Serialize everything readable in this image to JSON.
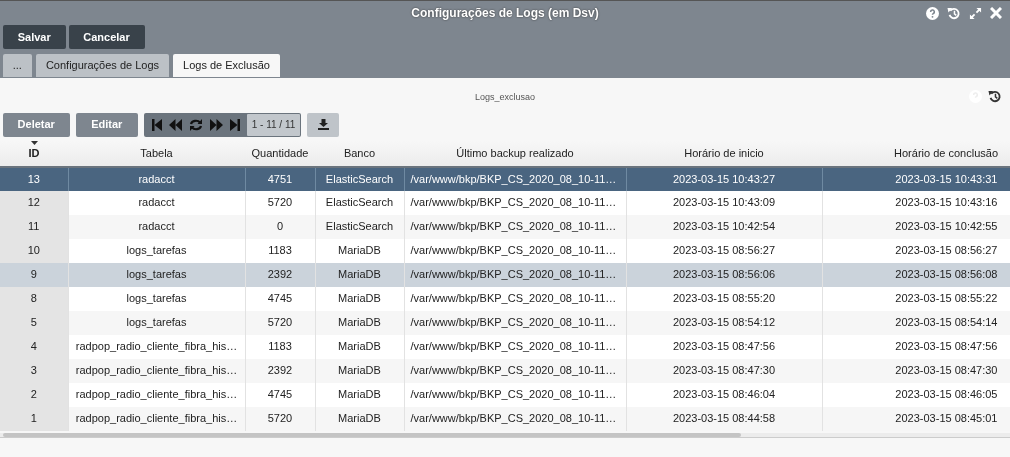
{
  "window": {
    "title": "Configurações de Logs (em Dsv)"
  },
  "actions": [
    "Salvar",
    "Cancelar"
  ],
  "tabs": [
    {
      "label": "...",
      "selected": false
    },
    {
      "label": "Configurações de Logs",
      "selected": false
    },
    {
      "label": "Logs de Exclusão",
      "selected": true
    }
  ],
  "panel": {
    "title": "Logs_exclusao"
  },
  "toolbar": {
    "buttons": [
      "Deletar",
      "Editar"
    ],
    "pager": "1 - 11 / 11"
  },
  "table": {
    "columns": [
      {
        "label": "ID",
        "sorted": true
      },
      {
        "label": "Tabela",
        "sorted": false
      },
      {
        "label": "Quantidade",
        "sorted": false
      },
      {
        "label": "Banco",
        "sorted": false
      },
      {
        "label": "Último backup realizado",
        "sorted": false
      },
      {
        "label": "Horário de inicio",
        "sorted": false
      },
      {
        "label": "Horário de conclusão",
        "sorted": false
      }
    ],
    "rows": [
      {
        "cells": [
          "13",
          "radacct",
          "4751",
          "ElasticSearch",
          "/var/www/bkp/BKP_CS_2020_08_10-11…",
          "2023-03-15 10:43:27",
          "2023-03-15 10:43:31"
        ],
        "selected": true,
        "hovered": false
      },
      {
        "cells": [
          "12",
          "radacct",
          "5720",
          "ElasticSearch",
          "/var/www/bkp/BKP_CS_2020_08_10-11…",
          "2023-03-15 10:43:09",
          "2023-03-15 10:43:16"
        ],
        "selected": false,
        "hovered": false
      },
      {
        "cells": [
          "11",
          "radacct",
          "0",
          "ElasticSearch",
          "/var/www/bkp/BKP_CS_2020_08_10-11…",
          "2023-03-15 10:42:54",
          "2023-03-15 10:42:55"
        ],
        "selected": false,
        "hovered": false
      },
      {
        "cells": [
          "10",
          "logs_tarefas",
          "1183",
          "MariaDB",
          "/var/www/bkp/BKP_CS_2020_08_10-11…",
          "2023-03-15 08:56:27",
          "2023-03-15 08:56:27"
        ],
        "selected": false,
        "hovered": false
      },
      {
        "cells": [
          "9",
          "logs_tarefas",
          "2392",
          "MariaDB",
          "/var/www/bkp/BKP_CS_2020_08_10-11…",
          "2023-03-15 08:56:06",
          "2023-03-15 08:56:08"
        ],
        "selected": false,
        "hovered": true
      },
      {
        "cells": [
          "8",
          "logs_tarefas",
          "4745",
          "MariaDB",
          "/var/www/bkp/BKP_CS_2020_08_10-11…",
          "2023-03-15 08:55:20",
          "2023-03-15 08:55:22"
        ],
        "selected": false,
        "hovered": false
      },
      {
        "cells": [
          "5",
          "logs_tarefas",
          "5720",
          "MariaDB",
          "/var/www/bkp/BKP_CS_2020_08_10-11…",
          "2023-03-15 08:54:12",
          "2023-03-15 08:54:14"
        ],
        "selected": false,
        "hovered": false
      },
      {
        "cells": [
          "4",
          "radpop_radio_cliente_fibra_his…",
          "1183",
          "MariaDB",
          "/var/www/bkp/BKP_CS_2020_08_10-11…",
          "2023-03-15 08:47:56",
          "2023-03-15 08:47:56"
        ],
        "selected": false,
        "hovered": false
      },
      {
        "cells": [
          "3",
          "radpop_radio_cliente_fibra_his…",
          "2392",
          "MariaDB",
          "/var/www/bkp/BKP_CS_2020_08_10-11…",
          "2023-03-15 08:47:30",
          "2023-03-15 08:47:30"
        ],
        "selected": false,
        "hovered": false
      },
      {
        "cells": [
          "2",
          "radpop_radio_cliente_fibra_his…",
          "4745",
          "MariaDB",
          "/var/www/bkp/BKP_CS_2020_08_10-11…",
          "2023-03-15 08:46:04",
          "2023-03-15 08:46:05"
        ],
        "selected": false,
        "hovered": false
      },
      {
        "cells": [
          "1",
          "radpop_radio_cliente_fibra_his…",
          "5720",
          "MariaDB",
          "/var/www/bkp/BKP_CS_2020_08_10-11…",
          "2023-03-15 08:44:58",
          "2023-03-15 08:45:01"
        ],
        "selected": false,
        "hovered": false
      }
    ]
  }
}
